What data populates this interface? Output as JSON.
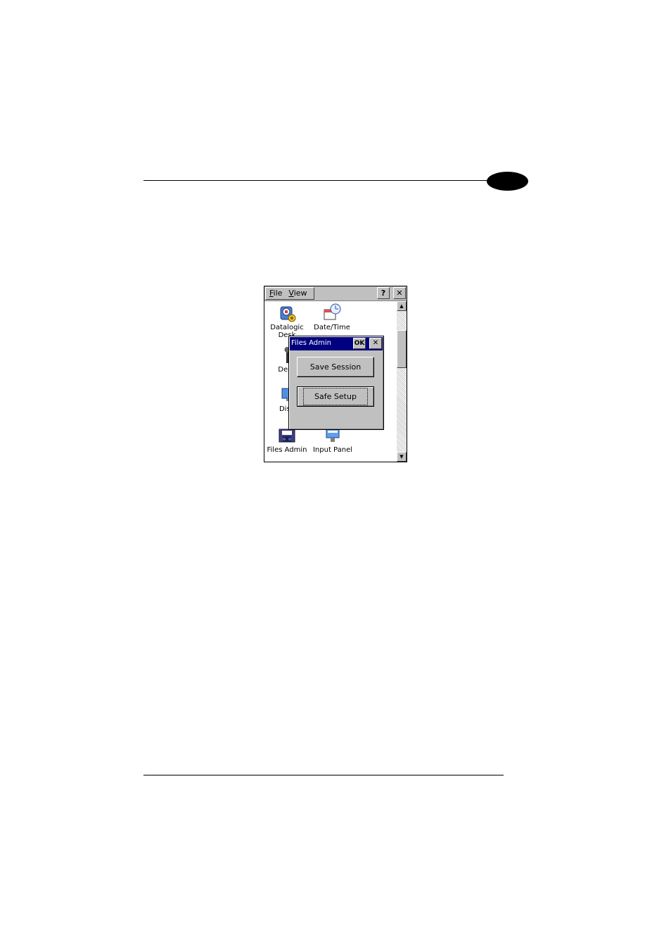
{
  "menubar": {
    "file_label": "File",
    "file_mnemonic": "F",
    "file_rest": "ile",
    "view_label": "View",
    "view_mnemonic": "V",
    "view_rest": "iew",
    "help_button": "?",
    "close_button": "✕"
  },
  "apps": [
    {
      "label_line1": "Datalogic",
      "label_line2": "Desk",
      "icon": "datalogic-desktop-icon"
    },
    {
      "label_line1": "Date/Time",
      "icon": "date-time-icon"
    },
    {
      "label_line1": "Deco",
      "icon": "decoding-wrench-icon"
    },
    {
      "label_line1": "Disp",
      "icon": "display-icon"
    },
    {
      "label_line1": "Files Admin",
      "icon": "files-admin-icon"
    },
    {
      "label_line1": "Input Panel",
      "icon": "input-panel-icon"
    }
  ],
  "dialog": {
    "title": "Files Admin",
    "ok_button": "OK",
    "close_button": "✕",
    "save_session_label": "Save Session",
    "safe_setup_label": "Safe Setup"
  },
  "scrollbar": {
    "up_arrow": "▲",
    "down_arrow": "▼"
  },
  "colors": {
    "title_bar": "#000080",
    "chrome": "#c0c0c0",
    "chapter_tab": "#000000"
  }
}
